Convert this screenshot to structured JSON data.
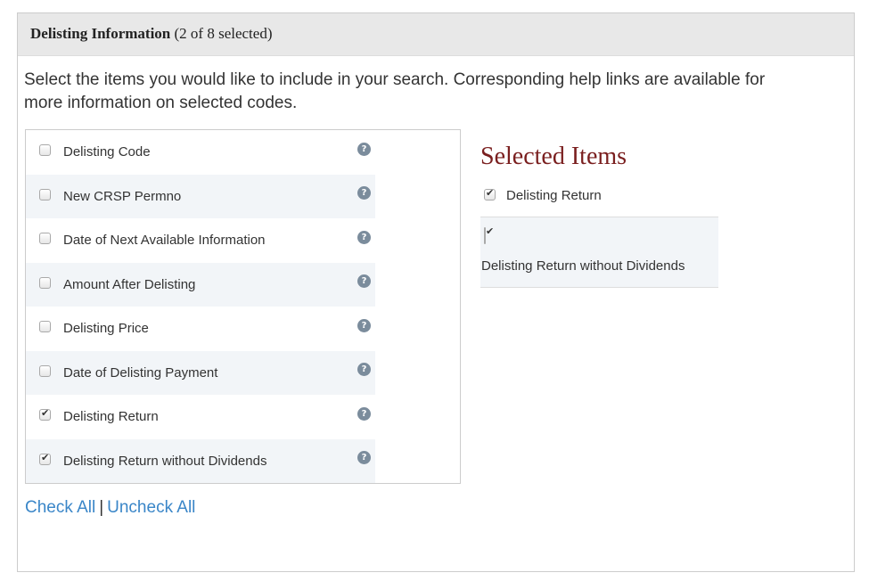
{
  "header": {
    "title": "Delisting Information",
    "count": "(2 of 8 selected)"
  },
  "intro": "Select the items you would like to include in your search. Corresponding help links are available for more information on selected codes.",
  "items": [
    {
      "label": "Delisting Code",
      "checked": false
    },
    {
      "label": "New CRSP Permno",
      "checked": false
    },
    {
      "label": "Date of Next Available Information",
      "checked": false
    },
    {
      "label": "Amount After Delisting",
      "checked": false
    },
    {
      "label": "Delisting Price",
      "checked": false
    },
    {
      "label": "Date of Delisting Payment",
      "checked": false
    },
    {
      "label": "Delisting Return",
      "checked": true
    },
    {
      "label": "Delisting Return without Dividends",
      "checked": true
    }
  ],
  "help_icon_glyph": "?",
  "links": {
    "check_all": "Check All",
    "separator": "|",
    "uncheck_all": "Uncheck All"
  },
  "selected": {
    "title": "Selected Items",
    "items": [
      {
        "label": "Delisting Return",
        "checked": true
      },
      {
        "label": "Delisting Return without Dividends",
        "checked": true
      }
    ]
  },
  "colors": {
    "accent_title": "#7a1f1f",
    "link": "#3a86c8",
    "help_icon": "#7b8c9c",
    "row_alt": "#f2f5f8"
  }
}
